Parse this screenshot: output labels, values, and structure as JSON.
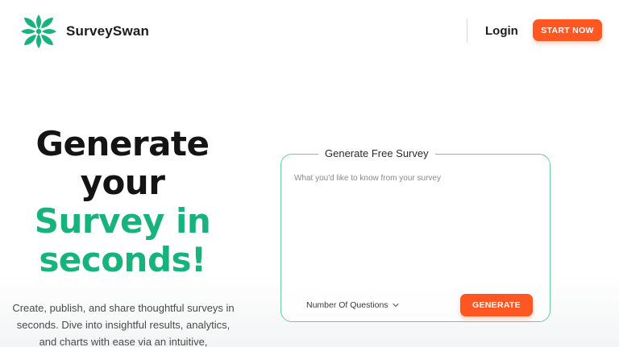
{
  "header": {
    "brand": "SurveySwan",
    "logo_icon": "swan-emblem-icon",
    "login_label": "Login",
    "start_label": "START NOW"
  },
  "hero": {
    "title_line1": "Generate",
    "title_line2": "your",
    "title_line3": "Survey in",
    "title_line4": "seconds!",
    "description": "Create, publish, and share thoughtful surveys in seconds. Dive into insightful results, analytics, and charts with ease via an intuitive,"
  },
  "survey_form": {
    "legend": "Generate Free Survey",
    "prompt_placeholder": "What you'd like to know from your survey",
    "prompt_value": "",
    "questions_label": "Number Of Questions",
    "questions_icon": "chevron-down-icon",
    "generate_label": "GENERATE"
  },
  "colors": {
    "brand_green": "#16b37c",
    "accent_orange": "#ff5722",
    "card_border": "#66cf9f"
  }
}
